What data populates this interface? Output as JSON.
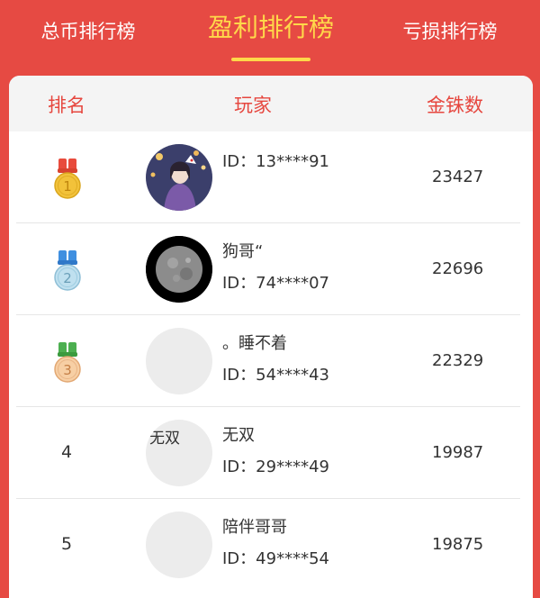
{
  "tabs": [
    {
      "label": "总币排行榜",
      "active": false
    },
    {
      "label": "盈利排行榜",
      "active": true
    },
    {
      "label": "亏损排行榜",
      "active": false
    }
  ],
  "table": {
    "headers": {
      "rank": "排名",
      "player": "玩家",
      "score": "金铢数"
    },
    "rows": [
      {
        "rank": "1",
        "medal": "gold-medal-icon",
        "name": "",
        "id": "ID：13****91",
        "score": "23427"
      },
      {
        "rank": "2",
        "medal": "silver-medal-icon",
        "name": "狗哥“",
        "id": "ID：74****07",
        "score": "22696"
      },
      {
        "rank": "3",
        "medal": "bronze-medal-icon",
        "name": "。睡不着",
        "id": "ID：54****43",
        "score": "22329"
      },
      {
        "rank": "4",
        "name": "无双",
        "avatar_text": "无双",
        "id": "ID：29****49",
        "score": "19987"
      },
      {
        "rank": "5",
        "name": "陪伴哥哥",
        "id": "ID：49****54",
        "score": "19875"
      }
    ]
  },
  "colors": {
    "background": "#e64a43",
    "active_tab": "#ffd84a",
    "header_text": "#e6473f",
    "gold": "#f2c23a",
    "silver": "#bfe0ef",
    "bronze": "#f7cfa4"
  }
}
